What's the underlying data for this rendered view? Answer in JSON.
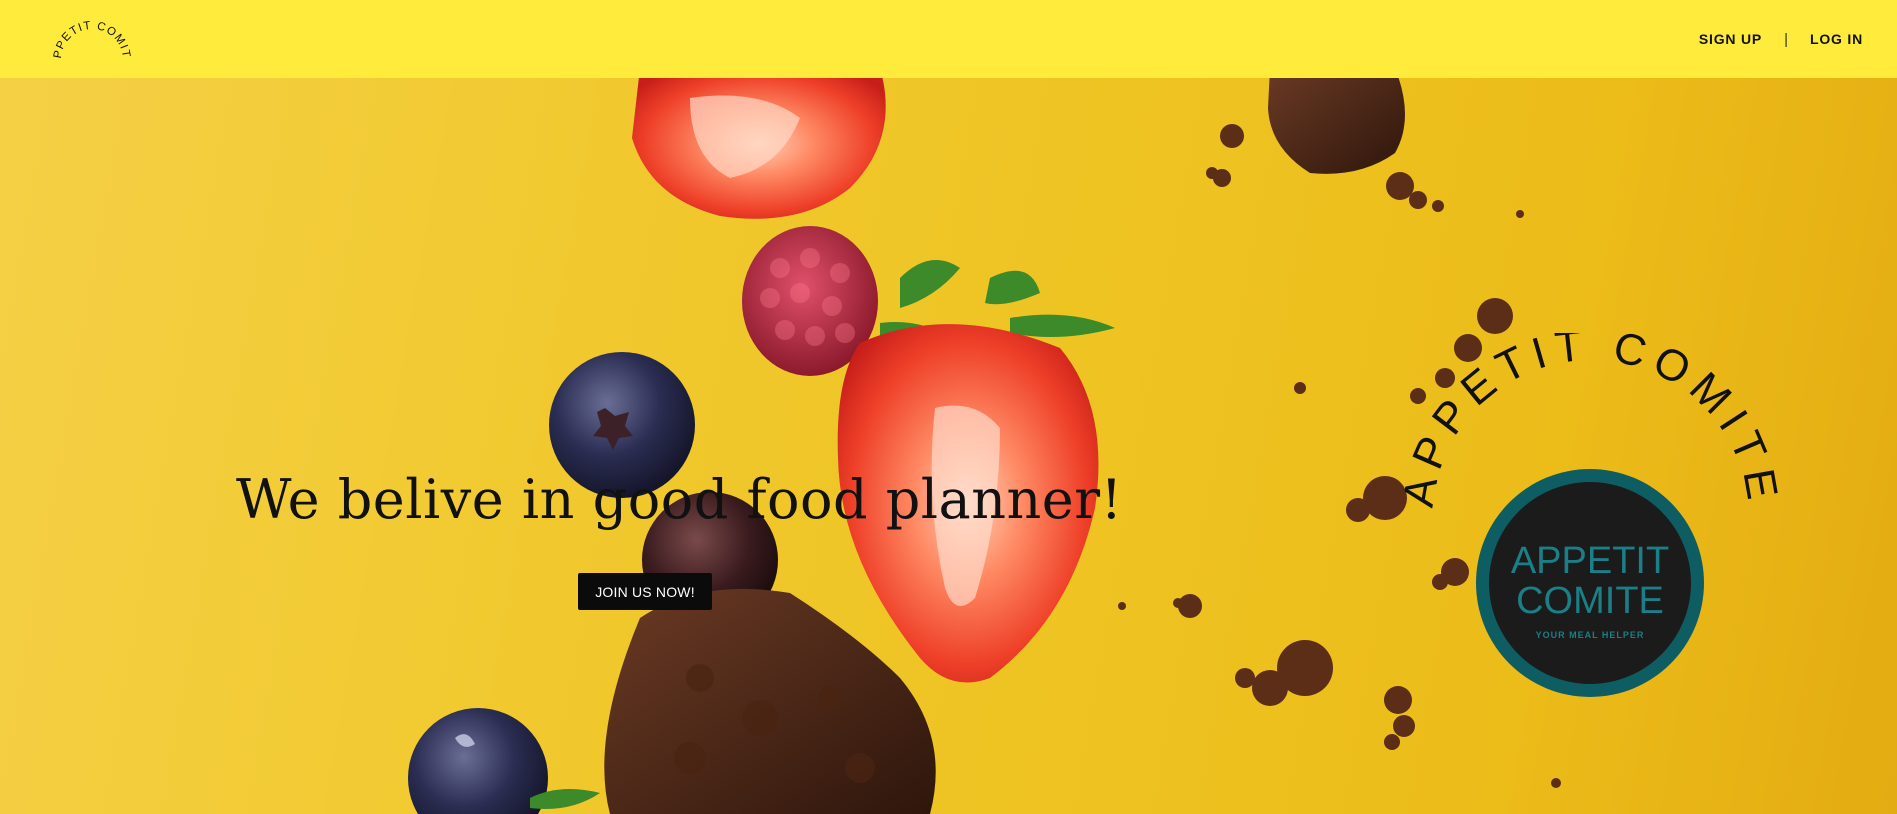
{
  "header": {
    "logo_text": "APPETIT COMITE",
    "nav": {
      "sign_up": "SIGN UP",
      "separator": "|",
      "log_in": "LOG IN"
    }
  },
  "hero": {
    "headline": "We belive in good food planner!",
    "cta_label": "JOIN US NOW!"
  },
  "badge": {
    "arc_text": "APPETIT COMITE",
    "emblem_line1": "APPETIT",
    "emblem_line2": "COMITE",
    "tagline": "YOUR MEAL HELPER"
  },
  "colors": {
    "header_bg": "#ffeb3b",
    "hero_bg": "#f1c92f",
    "emblem_ring": "#0e5d63",
    "emblem_core": "#1b1b1b",
    "emblem_text": "#1a7f86"
  },
  "icons": [
    "strawberry-image",
    "raspberry-image",
    "blueberry-image",
    "brownie-image",
    "crumb-image"
  ]
}
